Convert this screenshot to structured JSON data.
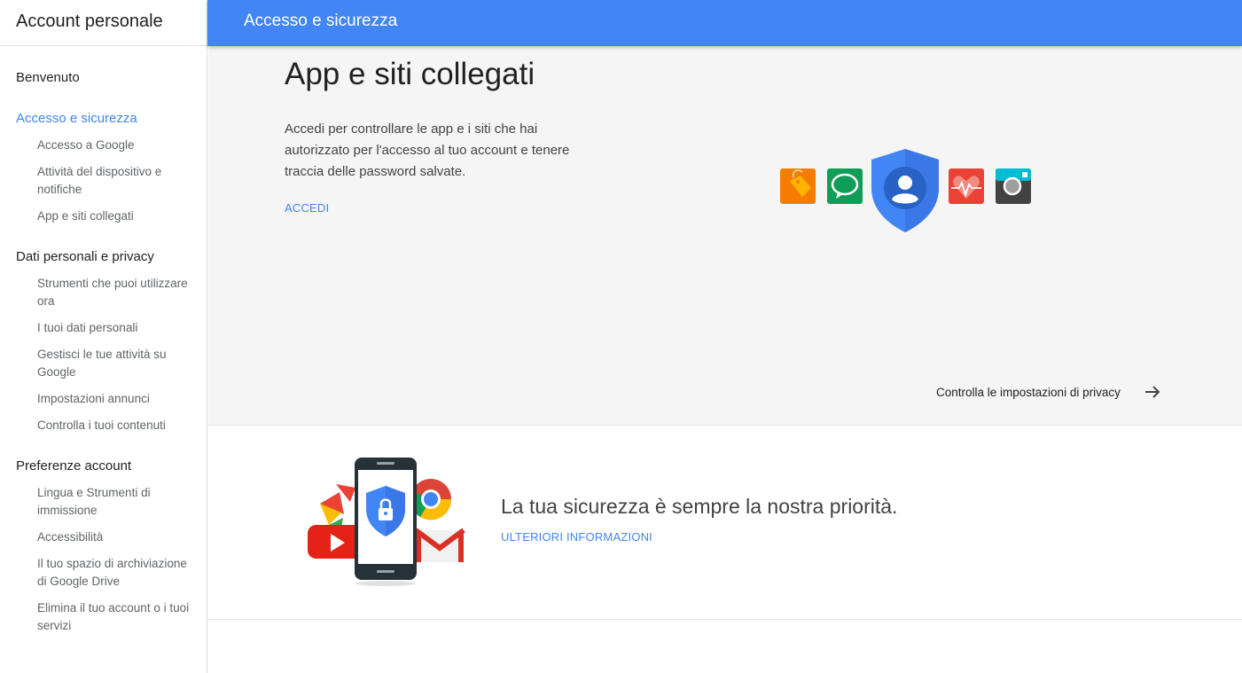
{
  "sidebar": {
    "title": "Account personale",
    "sections": [
      {
        "label": "Benvenuto",
        "active": false,
        "items": []
      },
      {
        "label": "Accesso e sicurezza",
        "active": true,
        "items": [
          "Accesso a Google",
          "Attività del dispositivo e notifiche",
          "App e siti collegati"
        ]
      },
      {
        "label": "Dati personali e privacy",
        "active": false,
        "items": [
          "Strumenti che puoi utilizzare ora",
          "I tuoi dati personali",
          "Gestisci le tue attività su Google",
          "Impostazioni annunci",
          "Controlla i tuoi contenuti"
        ]
      },
      {
        "label": "Preferenze account",
        "active": false,
        "items": [
          "Lingua e Strumenti di immissione",
          "Accessibilità",
          "Il tuo spazio di archiviazione di Google Drive",
          "Elimina il tuo account o i tuoi servizi"
        ]
      }
    ]
  },
  "header": {
    "title": "Accesso e sicurezza"
  },
  "hero": {
    "title": "App e siti collegati",
    "description": "Accedi per controllare le app e i siti che hai autorizzato per l'accesso al tuo account e tenere traccia delle password salvate.",
    "action_label": "ACCEDI",
    "icons": [
      "tag-app-icon",
      "chat-app-icon",
      "account-shield-icon",
      "health-app-icon",
      "camera-app-icon"
    ]
  },
  "privacy_link": {
    "label": "Controlla le impostazioni di privacy",
    "icon": "arrow-right-icon"
  },
  "security": {
    "heading": "La tua sicurezza è sempre la nostra priorità.",
    "action_label": "ULTERIORI INFORMAZIONI",
    "icons": [
      "phone-lock-icon",
      "youtube-icon",
      "photos-icon",
      "chrome-icon",
      "gmail-icon"
    ]
  },
  "colors": {
    "accent": "#4285f4",
    "hero_background": "#f5f5f5"
  }
}
